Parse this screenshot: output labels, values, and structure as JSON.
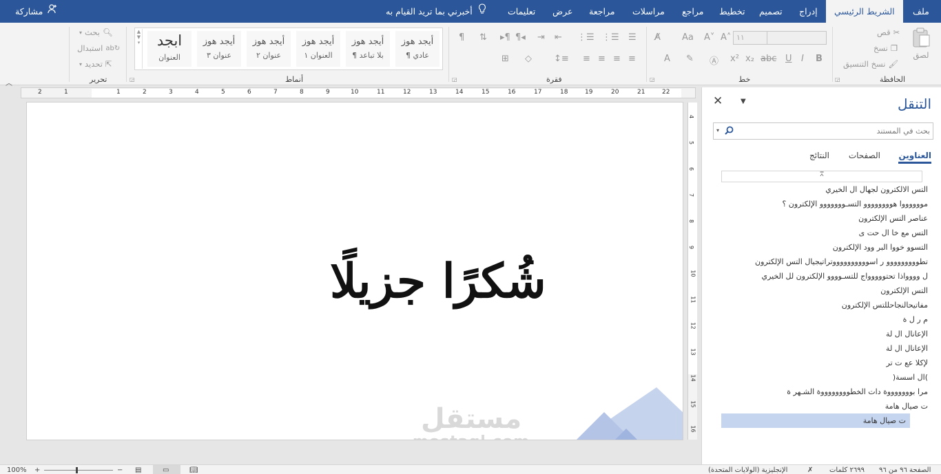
{
  "tabs": {
    "file": "ملف",
    "home": "الشريط الرئيسي",
    "insert": "إدراج",
    "design": "تصميم",
    "layout": "تخطيط",
    "references": "مراجع",
    "mailings": "مراسلات",
    "review": "مراجعة",
    "view": "عرض",
    "help": "تعليمات",
    "tell_me": "أخبرني بما تريد القيام به",
    "share": "مشاركة"
  },
  "ribbon": {
    "clipboard": {
      "label": "الحافظة",
      "paste": "لصق",
      "cut": "قص",
      "copy": "نسخ",
      "format_painter": "نسخ التنسيق"
    },
    "font": {
      "label": "خط",
      "size": "١١"
    },
    "paragraph": {
      "label": "فقرة"
    },
    "styles": {
      "label": "أنماط",
      "items": [
        {
          "sample": "أيجد هوز",
          "name": "¶ عادي"
        },
        {
          "sample": "أيجد هوز",
          "name": "¶ بلا تباعد"
        },
        {
          "sample": "أيجد هوز",
          "name": "العنوان ١"
        },
        {
          "sample": "أيجد هوز",
          "name": "عنوان ٢"
        },
        {
          "sample": "أيجد هوز",
          "name": "عنوان ٣"
        },
        {
          "sample": "ابجد",
          "name": "العنوان"
        }
      ]
    },
    "editing": {
      "label": "تحرير",
      "find": "بحث",
      "replace": "استبدال",
      "select": "تحديد"
    }
  },
  "ruler": {
    "numbers": [
      "2",
      "1",
      "1",
      "2",
      "3",
      "4",
      "5",
      "6",
      "7",
      "8",
      "9",
      "10",
      "11",
      "12",
      "13",
      "14",
      "15",
      "16",
      "17",
      "18",
      "19",
      "20",
      "21",
      "22"
    ]
  },
  "vruler": {
    "numbers": [
      "4",
      "5",
      "6",
      "7",
      "8",
      "9",
      "10",
      "11",
      "12",
      "13",
      "14",
      "15",
      "16"
    ]
  },
  "document": {
    "main_text": "شُكرًا جزيلًا",
    "watermark_ar": "مستقل",
    "watermark_en": "mostaql.com"
  },
  "nav": {
    "title": "التنقل",
    "search_placeholder": "بحث في المستند",
    "tab_headings": "العناوين",
    "tab_pages": "الصفحات",
    "tab_results": "النتائج",
    "items": [
      {
        "text": "التس     الالكترون لجهال ال    الخيري",
        "caret": false
      },
      {
        "text": "مووووووا هوووووووو التسـووووووو     الإلكترون ؟",
        "caret": false
      },
      {
        "text": "عناصر التس     الإلكترون",
        "caret": false
      },
      {
        "text": "التس     مع خا   ال حت ى",
        "caret": false
      },
      {
        "text": "التسوو     خووا  البر وود الإلكترون",
        "caret": true
      },
      {
        "text": "تطووووووووو  ر اسووووووووووتراتيجيال التس     الإلكترون",
        "caret": false
      },
      {
        "text": "ل وووواذا تحتووووواج للتسـوووو     الإلكترون  لل    الخيري",
        "caret": false
      },
      {
        "text": "التس     الإلكترون",
        "caret": false
      },
      {
        "text": "مفاتيحالنجاحللتس     الإلكترون",
        "caret": false
      },
      {
        "text": "م ر ل ة",
        "caret": false
      },
      {
        "text": "الإعانال ال    لة",
        "caret": false
      },
      {
        "text": "الإعانال ال    لة",
        "caret": false
      },
      {
        "text": "لإكلا  عع ت  تر",
        "caret": false
      },
      {
        "text": ")ال اسسة(",
        "caret": false
      },
      {
        "text": "مرا بوووووووة   دات الخطووووووووة الشـهر ة",
        "caret": true
      },
      {
        "text": "ت صيال هامة",
        "caret": false
      },
      {
        "text": "ت صيال هامة",
        "caret": false,
        "selected": true
      }
    ]
  },
  "status": {
    "page": "الصفحة ٩٦ من ٩٦",
    "words": "٢٦٩٩ كلمات",
    "language": "الإنجليزية (الولايات المتحدة)",
    "zoom": "100%"
  },
  "colors": {
    "accent": "#2b579a",
    "selection": "#c5d5f0",
    "ribbon_bg": "#f3f3f3"
  }
}
